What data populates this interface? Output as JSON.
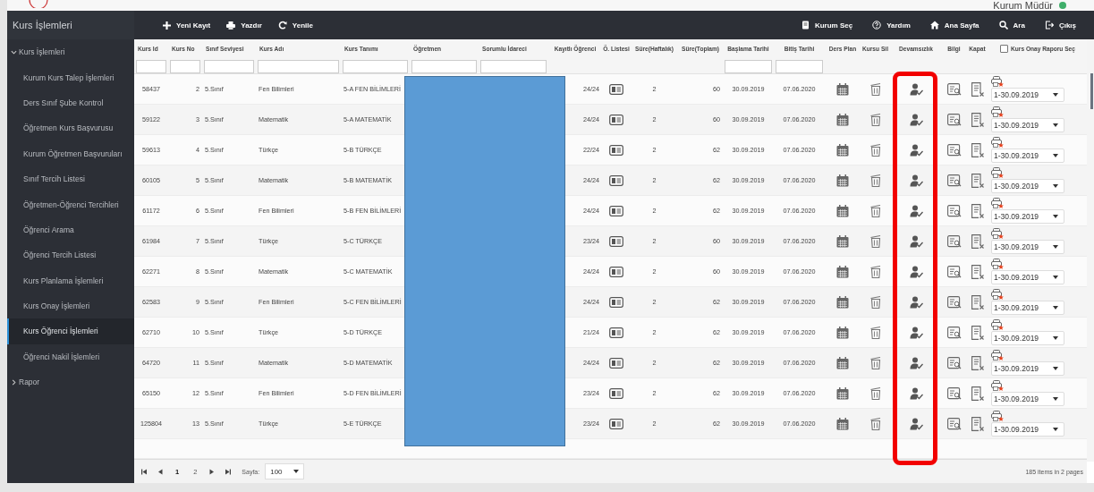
{
  "header": {
    "user": "Kurum Müdür"
  },
  "sidebar": {
    "title": "Kurs İşlemleri",
    "items": [
      {
        "label": "Kurs İşlemleri",
        "expanded": true,
        "selected": false,
        "children": [
          {
            "label": "Kurum Kurs Talep İşlemleri",
            "selected": false
          },
          {
            "label": "Ders Sınıf Şube Kontrol",
            "selected": false
          },
          {
            "label": "Öğretmen Kurs Başvurusu",
            "selected": false
          },
          {
            "label": "Kurum Öğretmen Başvuruları",
            "selected": false
          },
          {
            "label": "Sınıf Tercih Listesi",
            "selected": false
          },
          {
            "label": "Öğretmen-Öğrenci Tercihleri",
            "selected": false
          },
          {
            "label": "Öğrenci Arama",
            "selected": false
          },
          {
            "label": "Öğrenci Tercih Listesi",
            "selected": false
          },
          {
            "label": "Kurs Planlama İşlemleri",
            "selected": false
          },
          {
            "label": "Kurs Onay İşlemleri",
            "selected": false
          },
          {
            "label": "Kurs Öğrenci İşlemleri",
            "selected": true
          },
          {
            "label": "Öğrenci Nakil İşlemleri",
            "selected": false
          }
        ]
      },
      {
        "label": "Rapor",
        "expanded": false,
        "selected": false
      }
    ]
  },
  "toolbar": {
    "left": [
      {
        "kind": "plus",
        "label": "Yeni Kayıt"
      },
      {
        "kind": "printer",
        "label": "Yazdır"
      },
      {
        "kind": "refresh",
        "label": "Yenile"
      }
    ],
    "right": [
      {
        "kind": "book",
        "label": "Kurum Seç"
      },
      {
        "kind": "help",
        "label": "Yardım"
      },
      {
        "kind": "home",
        "label": "Ana Sayfa"
      },
      {
        "kind": "search",
        "label": "Ara"
      },
      {
        "kind": "logout",
        "label": "Çıkış"
      }
    ]
  },
  "table": {
    "columns": [
      {
        "label": "Kurs Id",
        "kind": "text",
        "filter": true
      },
      {
        "label": "Kurs No",
        "kind": "text",
        "filter": true
      },
      {
        "label": "Sınıf Seviyesi",
        "kind": "text",
        "filter": true
      },
      {
        "label": "Kurs Adı",
        "kind": "text",
        "filter": true
      },
      {
        "label": "Kurs Tanımı",
        "kind": "text",
        "filter": true
      },
      {
        "label": "Öğretmen",
        "kind": "blank",
        "filter": true
      },
      {
        "label": "Sorumlu İdareci",
        "kind": "blank",
        "filter": true
      },
      {
        "label": "Kayıtlı Öğrenci",
        "kind": "text",
        "filter": false
      },
      {
        "label": "Ö. Listesi",
        "kind": "student-list",
        "filter": false
      },
      {
        "label": "Süre(Haftalık)",
        "kind": "text",
        "filter": false
      },
      {
        "label": "Süre(Toplam)",
        "kind": "text",
        "filter": false
      },
      {
        "label": "Başlama Tarihi",
        "kind": "text",
        "filter": true
      },
      {
        "label": "Bitiş Tarihi",
        "kind": "text",
        "filter": true
      },
      {
        "label": "Ders Plan",
        "kind": "plan",
        "filter": false
      },
      {
        "label": "Kursu Sil",
        "kind": "delete",
        "filter": false
      },
      {
        "label": "Devamsızlık",
        "kind": "attendance",
        "filter": false
      },
      {
        "label": "Bilgi",
        "kind": "info",
        "filter": false
      },
      {
        "label": "Kapat",
        "kind": "close",
        "filter": false
      },
      {
        "label": "Kurs Onay Raporu Seç",
        "kind": "report",
        "filter": false,
        "checked": false
      }
    ],
    "rows": [
      {
        "values": [
          "58437",
          "2",
          "5.Sınıf",
          "Fen Bilimleri",
          "5-A FEN BİLİMLERİ",
          "24/24",
          "2",
          "60",
          "30.09.2019",
          "07.06.2020"
        ],
        "report": "1-30.09.2019"
      },
      {
        "values": [
          "59122",
          "3",
          "5.Sınıf",
          "Matematik",
          "5-A MATEMATİK",
          "24/24",
          "2",
          "60",
          "30.09.2019",
          "07.06.2020"
        ],
        "report": "1-30.09.2019"
      },
      {
        "values": [
          "59613",
          "4",
          "5.Sınıf",
          "Türkçe",
          "5-B TÜRKÇE",
          "22/24",
          "2",
          "62",
          "30.09.2019",
          "07.06.2020"
        ],
        "report": "1-30.09.2019"
      },
      {
        "values": [
          "60105",
          "5",
          "5.Sınıf",
          "Matematik",
          "5-B MATEMATİK",
          "24/24",
          "2",
          "62",
          "30.09.2019",
          "07.06.2020"
        ],
        "report": "1-30.09.2019"
      },
      {
        "values": [
          "61172",
          "6",
          "5.Sınıf",
          "Fen Bilimleri",
          "5-B FEN BİLİMLERİ",
          "24/24",
          "2",
          "62",
          "30.09.2019",
          "07.06.2020"
        ],
        "report": "1-30.09.2019"
      },
      {
        "values": [
          "61984",
          "7",
          "5.Sınıf",
          "Türkçe",
          "5-C TÜRKÇE",
          "23/24",
          "2",
          "60",
          "30.09.2019",
          "07.06.2020"
        ],
        "report": "1-30.09.2019"
      },
      {
        "values": [
          "62271",
          "8",
          "5.Sınıf",
          "Matematik",
          "5-C MATEMATİK",
          "24/24",
          "2",
          "60",
          "30.09.2019",
          "07.06.2020"
        ],
        "report": "1-30.09.2019"
      },
      {
        "values": [
          "62583",
          "9",
          "5.Sınıf",
          "Fen Bilimleri",
          "5-C FEN BİLİMLERİ",
          "24/24",
          "2",
          "62",
          "30.09.2019",
          "07.06.2020"
        ],
        "report": "1-30.09.2019"
      },
      {
        "values": [
          "62710",
          "10",
          "5.Sınıf",
          "Türkçe",
          "5-D TÜRKÇE",
          "21/24",
          "2",
          "62",
          "30.09.2019",
          "07.06.2020"
        ],
        "report": "1-30.09.2019"
      },
      {
        "values": [
          "64720",
          "11",
          "5.Sınıf",
          "Matematik",
          "5-D MATEMATİK",
          "24/24",
          "2",
          "62",
          "30.09.2019",
          "07.06.2020"
        ],
        "report": "1-30.09.2019"
      },
      {
        "values": [
          "65150",
          "12",
          "5.Sınıf",
          "Fen Bilimleri",
          "5-D FEN BİLİMLERİ",
          "23/24",
          "2",
          "62",
          "30.09.2019",
          "07.06.2020"
        ],
        "report": "1-30.09.2019"
      },
      {
        "values": [
          "125804",
          "13",
          "5.Sınıf",
          "Türkçe",
          "5-E TÜRKÇE",
          "23/24",
          "2",
          "62",
          "30.09.2019",
          "07.06.2020"
        ],
        "report": "1-30.09.2019"
      }
    ]
  },
  "pager": {
    "pages": [
      {
        "label": "1",
        "selected": true
      },
      {
        "label": "2",
        "selected": false
      }
    ],
    "size_label": "Sayfa:",
    "size": "100",
    "summary": "185 items in 2 pages"
  }
}
